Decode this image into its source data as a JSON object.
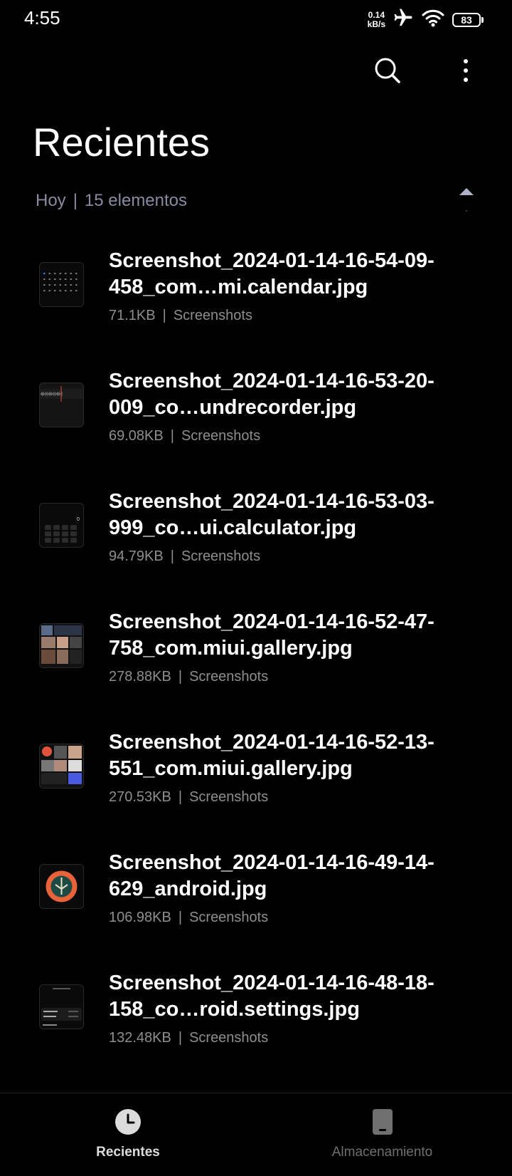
{
  "status": {
    "time": "4:55",
    "net_speed_value": "0.14",
    "net_speed_unit": "kB/s",
    "battery": "83"
  },
  "title": "Recientes",
  "section": {
    "day": "Hoy",
    "separator": "|",
    "count": "15 elementos"
  },
  "files": [
    {
      "name": "Screenshot_2024-01-14-16-54-09-458_com…mi.calendar.jpg",
      "size": "71.1KB",
      "folder": "Screenshots",
      "thumb": "calendar"
    },
    {
      "name": "Screenshot_2024-01-14-16-53-20-009_co…undrecorder.jpg",
      "size": "69.08KB",
      "folder": "Screenshots",
      "thumb": "recorder"
    },
    {
      "name": "Screenshot_2024-01-14-16-53-03-999_co…ui.calculator.jpg",
      "size": "94.79KB",
      "folder": "Screenshots",
      "thumb": "calculator"
    },
    {
      "name": "Screenshot_2024-01-14-16-52-47-758_com.miui.gallery.jpg",
      "size": "278.88KB",
      "folder": "Screenshots",
      "thumb": "gallery"
    },
    {
      "name": "Screenshot_2024-01-14-16-52-13-551_com.miui.gallery.jpg",
      "size": "270.53KB",
      "folder": "Screenshots",
      "thumb": "gallery2"
    },
    {
      "name": "Screenshot_2024-01-14-16-49-14-629_android.jpg",
      "size": "106.98KB",
      "folder": "Screenshots",
      "thumb": "android"
    },
    {
      "name": "Screenshot_2024-01-14-16-48-18-158_co…roid.settings.jpg",
      "size": "132.48KB",
      "folder": "Screenshots",
      "thumb": "settings"
    }
  ],
  "nav": {
    "recent_label": "Recientes",
    "storage_label": "Almacenamiento"
  },
  "icons": {
    "search": "search-icon",
    "more": "more-vert-icon",
    "collapse": "chevron-up-icon",
    "recent": "clock-icon",
    "storage": "phone-storage-icon"
  },
  "colors": {
    "background": "#000000",
    "section_text": "#8a8aa3",
    "meta_text": "#8e8e8e"
  }
}
